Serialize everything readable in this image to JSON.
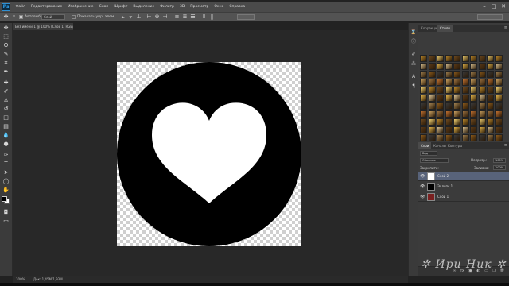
{
  "app": {
    "logo": "Ps"
  },
  "menu": [
    "Файл",
    "Редактирование",
    "Изображение",
    "Слои",
    "Шрифт",
    "Выделение",
    "Фильтр",
    "3D",
    "Просмотр",
    "Окно",
    "Справка"
  ],
  "window_controls": [
    "–",
    "□",
    "✕"
  ],
  "options": {
    "tool_icon": "move-tool-icon",
    "auto_select_label": "Автовыбор:",
    "auto_select_value": "Слой",
    "transform_label": "Показать упр. элем."
  },
  "document": {
    "tab_title": "Без имени-1 @ 100% (Слой 1, RGB/8)",
    "status_zoom": "100%",
    "status_doc": "Док: 1,45M/1,93M"
  },
  "panels": {
    "top_tabs": [
      "Коррекция",
      "Стили"
    ],
    "layers_tabs": [
      "Слои",
      "Каналы",
      "Контуры"
    ],
    "kind_label": "Вид",
    "blend_mode": "Обычные",
    "opacity_label": "Непрозр.:",
    "opacity_value": "100%",
    "lock_label": "Закрепить:",
    "fill_label": "Заливка:",
    "fill_value": "100%",
    "layers": [
      {
        "name": "Слой 2",
        "thumb_color": "#ffffff",
        "selected": true
      },
      {
        "name": "Эллипс 1",
        "thumb_color": "#000000",
        "selected": false
      },
      {
        "name": "Слой 1",
        "thumb_color": "#7a2020",
        "selected": false
      }
    ]
  },
  "watermark": "✲ Ири Ник ✲",
  "colors": {
    "accent_selected": "#58637a",
    "canvas_circle": "#000000",
    "heart": "#ffffff"
  }
}
